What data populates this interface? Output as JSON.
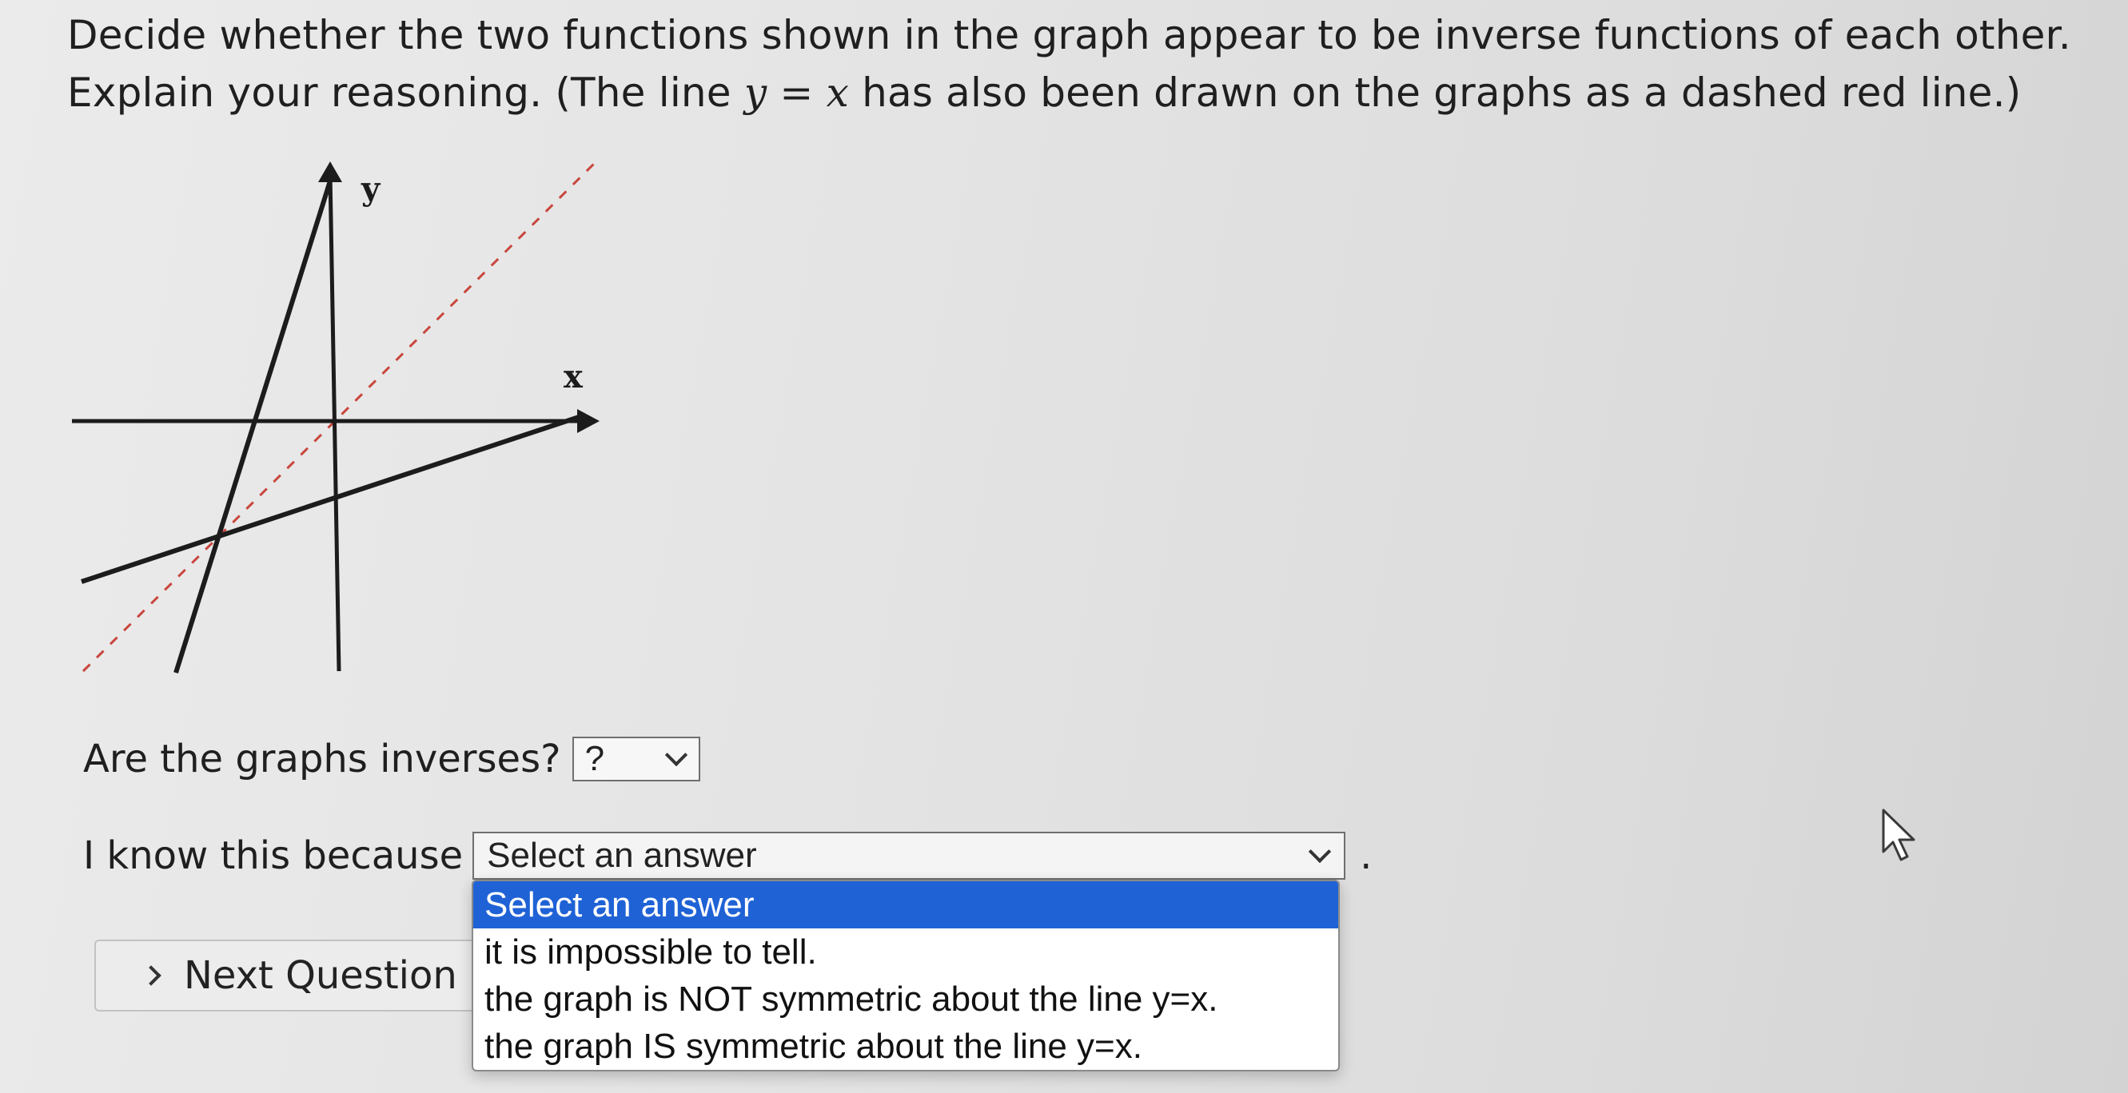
{
  "question": {
    "text_before": "Decide whether the two functions shown in the graph appear to be inverse functions of each other. Explain your reasoning. (The line ",
    "math": "y = x",
    "text_after": " has also been drawn on the graphs as a dashed red line.)"
  },
  "graph": {
    "x_axis_label": "x",
    "y_axis_label": "y",
    "line_color": "#1c1c1c",
    "dashed_line_color": "#c9463d"
  },
  "q1": {
    "label": "Are the graphs inverses?",
    "selected": "?"
  },
  "q2": {
    "label": "I know this because",
    "selected": "Select an answer",
    "trailing": ".",
    "options": [
      "Select an answer",
      "it is impossible to tell.",
      "the graph is NOT symmetric about the line y=x.",
      "the graph IS symmetric about the line y=x."
    ],
    "highlight_color": "#1f62d6"
  },
  "next_button": {
    "label": "Next Question"
  },
  "icons": {
    "cursor": "pointer-cursor-icon",
    "chevron": "chevron-down-icon",
    "next": "chevron-right-icon"
  }
}
